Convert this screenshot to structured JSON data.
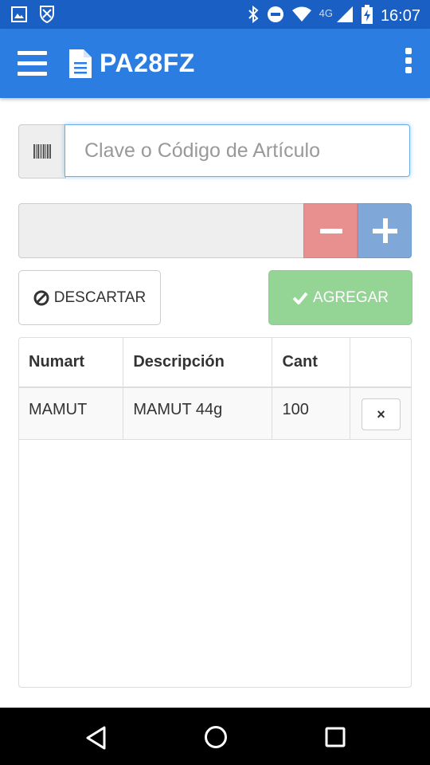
{
  "status_bar": {
    "network": "4G",
    "time": "16:07",
    "icons": [
      "image-icon",
      "shield-notification-icon",
      "bluetooth-icon",
      "do-not-disturb-icon",
      "wifi-icon",
      "signal-icon",
      "battery-charging-icon"
    ]
  },
  "app_bar": {
    "title": "PA28FZ",
    "menu_icon": "hamburger-menu-icon",
    "title_icon": "document-icon",
    "overflow_icon": "more-vert-icon",
    "background": "#2b7de1"
  },
  "search": {
    "addon_icon": "barcode-icon",
    "value": "",
    "placeholder": "Clave o Código de Artículo"
  },
  "quantity": {
    "value": "",
    "minus_color": "#e89090",
    "plus_color": "#7fa8d8"
  },
  "actions": {
    "discard_label": "DESCARTAR",
    "discard_icon": "ban-icon",
    "add_label": "AGREGAR",
    "add_icon": "check-icon",
    "add_color": "#94d494"
  },
  "table": {
    "headers": [
      "Numart",
      "Descripción",
      "Cant",
      ""
    ],
    "rows": [
      {
        "numart": "MAMUT",
        "descripcion": "MAMUT 44g",
        "cant": "100",
        "remove_label": "×"
      }
    ]
  },
  "nav_bar": {
    "icons": [
      "back-icon",
      "home-icon",
      "recents-icon"
    ]
  }
}
